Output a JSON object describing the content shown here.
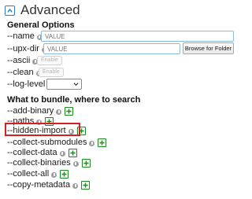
{
  "header": {
    "title": "Advanced"
  },
  "general": {
    "title": "General Options",
    "name": {
      "label": "--name",
      "placeholder": "VALUE"
    },
    "upx_dir": {
      "label": "--upx-dir",
      "placeholder": "VALUE",
      "browse_label": "Browse for Folder"
    },
    "ascii": {
      "label": "--ascii",
      "toggle_label": "Enable"
    },
    "clean": {
      "label": "--clean",
      "toggle_label": "Enable"
    },
    "log_level": {
      "label": "--log-level",
      "value": ""
    }
  },
  "bundle": {
    "title": "What to bundle, where to search",
    "options": [
      {
        "label": "--add-binary"
      },
      {
        "label": "--paths"
      },
      {
        "label": "--hidden-import"
      },
      {
        "label": "--collect-submodules"
      },
      {
        "label": "--collect-data"
      },
      {
        "label": "--collect-binaries"
      },
      {
        "label": "--collect-all"
      },
      {
        "label": "--copy-metadata"
      }
    ]
  },
  "colors": {
    "accent": "#2b7bd0",
    "plus_green": "#1e8a24",
    "highlight_red": "#d32121"
  },
  "icons": {
    "collapse": "chevron-up-icon",
    "help": "help-icon",
    "add": "plus-icon"
  }
}
